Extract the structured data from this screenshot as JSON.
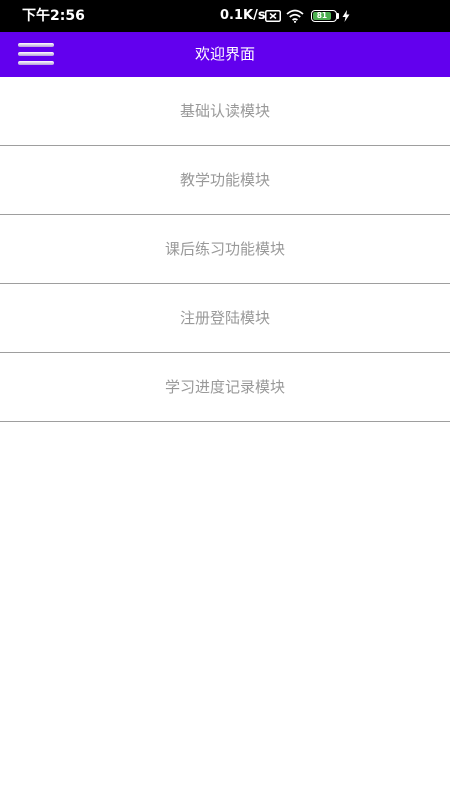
{
  "status_bar": {
    "time": "下午2:56",
    "net_speed": "0.1K/s",
    "battery_level": "81",
    "battery_fraction": 0.81,
    "icons": [
      "sim-x-icon",
      "wifi-icon",
      "battery-icon",
      "charging-icon"
    ]
  },
  "app_bar": {
    "title": "欢迎界面",
    "menu_icon": "hamburger-menu-icon",
    "color": "#6200ee"
  },
  "modules": [
    {
      "label": "基础认读模块"
    },
    {
      "label": "教学功能模块"
    },
    {
      "label": "课后练习功能模块"
    },
    {
      "label": "注册登陆模块"
    },
    {
      "label": "学习进度记录模块"
    }
  ]
}
